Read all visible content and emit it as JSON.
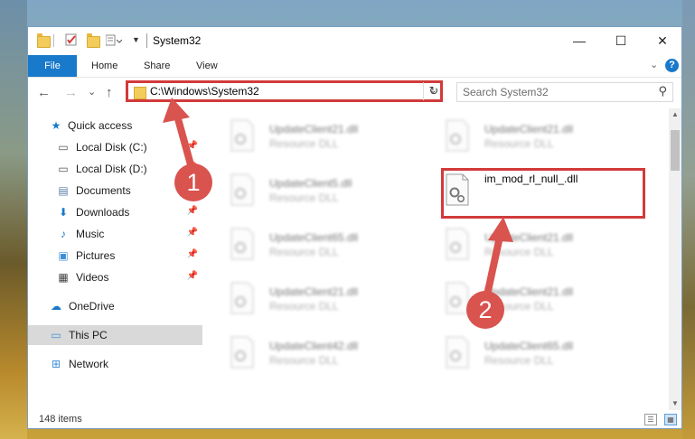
{
  "window": {
    "title": "System32",
    "minimize_glyph": "—",
    "maximize_glyph": "☐",
    "close_glyph": "✕"
  },
  "ribbon": {
    "file_label": "File",
    "tabs": [
      {
        "label": "Home"
      },
      {
        "label": "Share"
      },
      {
        "label": "View"
      }
    ],
    "expand_glyph": "⌄",
    "help_glyph": "?"
  },
  "navigation": {
    "back_glyph": "←",
    "forward_glyph": "→",
    "recent_glyph": "⌄",
    "up_glyph": "↑",
    "address": "C:\\Windows\\System32",
    "address_dropdown_glyph": "⌄",
    "refresh_glyph": "↻",
    "search_placeholder": "Search System32",
    "search_glyph": "⚲"
  },
  "sidebar": {
    "items": [
      {
        "label": "Quick access",
        "icon": "star-icon",
        "glyph": "★",
        "color": "#1979ca",
        "pinned": false
      },
      {
        "label": "Local Disk (C:)",
        "icon": "drive-icon",
        "glyph": "▭",
        "color": "#555555",
        "pinned": true
      },
      {
        "label": "Local Disk (D:)",
        "icon": "drive-icon",
        "glyph": "▭",
        "color": "#555555",
        "pinned": true
      },
      {
        "label": "Documents",
        "icon": "documents-icon",
        "glyph": "▤",
        "color": "#5b7ea6",
        "pinned": true
      },
      {
        "label": "Downloads",
        "icon": "downloads-icon",
        "glyph": "⬇",
        "color": "#1979ca",
        "pinned": true
      },
      {
        "label": "Music",
        "icon": "music-icon",
        "glyph": "♪",
        "color": "#1979ca",
        "pinned": true
      },
      {
        "label": "Pictures",
        "icon": "pictures-icon",
        "glyph": "▣",
        "color": "#3d8fd6",
        "pinned": true
      },
      {
        "label": "Videos",
        "icon": "videos-icon",
        "glyph": "▦",
        "color": "#444444",
        "pinned": true
      },
      {
        "label": "OneDrive",
        "icon": "onedrive-icon",
        "glyph": "☁",
        "color": "#1979ca",
        "pinned": false
      },
      {
        "label": "This PC",
        "icon": "computer-icon",
        "glyph": "▭",
        "color": "#3d8fd6",
        "pinned": false,
        "selected": true
      },
      {
        "label": "Network",
        "icon": "network-icon",
        "glyph": "⊞",
        "color": "#3d8fd6",
        "pinned": false
      }
    ],
    "pin_glyph": "📌"
  },
  "files": [
    {
      "name": "UpdateClient21.dll",
      "type": "Resource DLL",
      "blurred": true
    },
    {
      "name": "UpdateClient21.dll",
      "type": "Resource DLL",
      "blurred": true
    },
    {
      "name": "UpdateClient5.dll",
      "type": "Resource DLL",
      "blurred": true
    },
    {
      "name": "im_mod_rl_null_.dll",
      "type": "",
      "blurred": false
    },
    {
      "name": "UpdateClient65.dll",
      "type": "Resource DLL",
      "blurred": true
    },
    {
      "name": "UpdateClient21.dll",
      "type": "Resource DLL",
      "blurred": true
    },
    {
      "name": "UpdateClient21.dll",
      "type": "Resource DLL",
      "blurred": true
    },
    {
      "name": "UpdateClient21.dll",
      "type": "Resource DLL",
      "blurred": true
    },
    {
      "name": "UpdateClient42.dll",
      "type": "Resource DLL",
      "blurred": true
    },
    {
      "name": "UpdateClient65.dll",
      "type": "Resource DLL",
      "blurred": true
    }
  ],
  "annotations": {
    "step1": "1",
    "step2": "2",
    "color": "#d23a3a"
  },
  "status": {
    "item_count": "148 items"
  }
}
